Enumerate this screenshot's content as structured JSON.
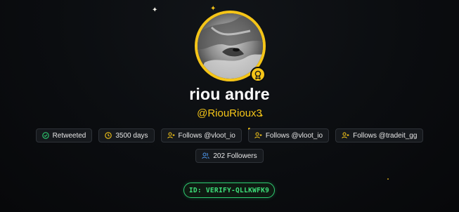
{
  "profile": {
    "name": "riou andre",
    "handle": "@RiouRioux3",
    "avatar_alt": "profile-photo"
  },
  "colors": {
    "accent": "#f5c518",
    "background": "#0b0d10",
    "verify_green": "#2ecc71",
    "chip_border": "#2e3238",
    "chip_text": "#e6e6e6"
  },
  "chips_row1": [
    {
      "label": "Retweeted",
      "icon": "check-circle-icon",
      "icon_color": "#2ecc71"
    },
    {
      "label": "3500 days",
      "icon": "clock-icon",
      "icon_color": "#f5c518"
    },
    {
      "label": "Follows @vloot_io",
      "icon": "user-plus-icon",
      "icon_color": "#f5c518"
    },
    {
      "label": "Follows @vloot_io",
      "icon": "user-plus-icon",
      "icon_color": "#f5c518"
    },
    {
      "label": "Follows @tradeit_gg",
      "icon": "user-plus-icon",
      "icon_color": "#f5c518"
    }
  ],
  "chips_row2": [
    {
      "label": "202 Followers",
      "icon": "users-icon",
      "icon_color": "#4a90e2"
    }
  ],
  "verify": {
    "label": "ID: VERIFY-QLLKWFK9"
  },
  "badge_icon": "award-ribbon-icon"
}
